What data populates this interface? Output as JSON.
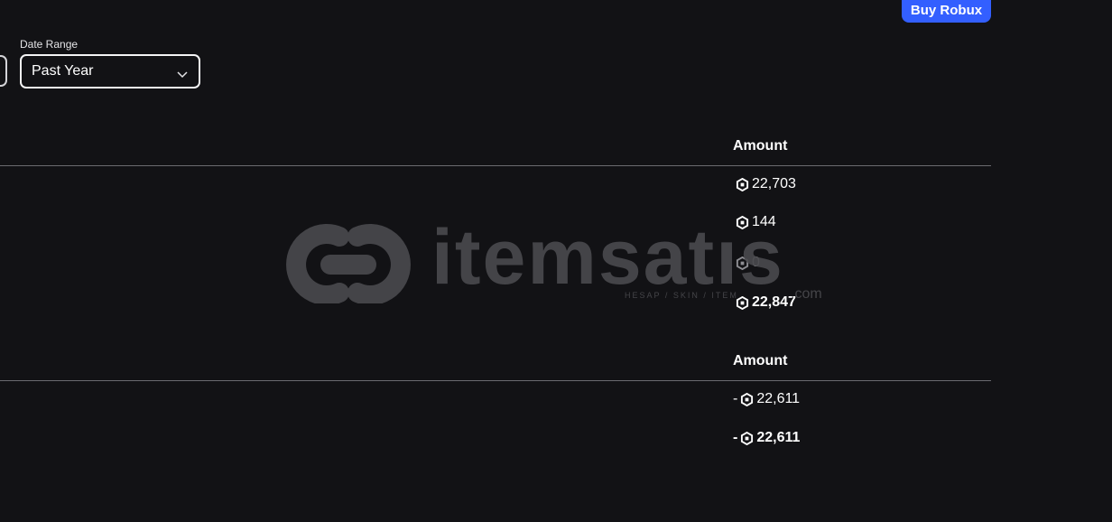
{
  "header": {
    "buy_label": "Buy Robux"
  },
  "filters": {
    "date_range_label": "Date Range",
    "date_range_value": "Past Year"
  },
  "section1": {
    "amount_header": "Amount",
    "rows": [
      "22,703",
      "144",
      "0",
      "22,847"
    ]
  },
  "section2": {
    "amount_header": "Amount",
    "rows": [
      "22,611",
      "22,611"
    ],
    "sign": "-"
  },
  "watermark": {
    "brand": "itemsatis",
    "tagline": "HESAP / SKIN / ITEM",
    "suffix": ".com"
  },
  "colors": {
    "accent": "#335fff",
    "background": "#121215",
    "text": "#f4f4f5",
    "muted": "#8e8e93"
  },
  "icons": {
    "currency": "robux-icon",
    "dropdown": "chevron-down-icon"
  }
}
